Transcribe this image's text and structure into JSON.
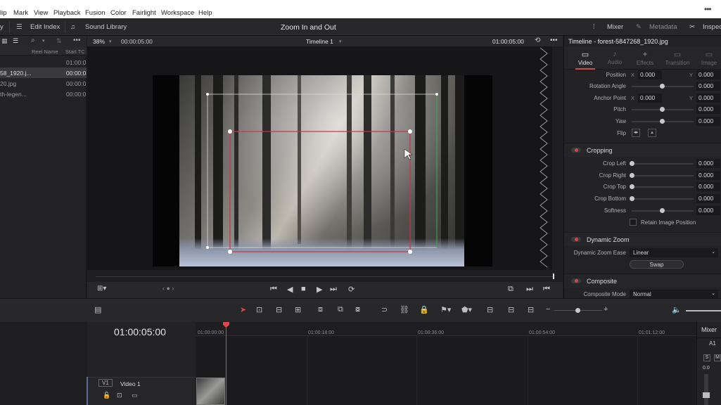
{
  "menubar": {
    "items": [
      "lip",
      "Mark",
      "View",
      "Playback",
      "Fusion",
      "Color",
      "Fairlight",
      "Workspace",
      "Help"
    ]
  },
  "toolbar": {
    "left_fragment": "y",
    "edit_index": "Edit Index",
    "sound_library": "Sound Library",
    "title": "Zoom In and Out",
    "mixer": "Mixer",
    "metadata": "Metadata",
    "inspector": "Inspec"
  },
  "pool": {
    "col_reel": "Reel Name",
    "col_start": "Start TC",
    "rows": [
      {
        "name": "",
        "tc": "01:00:0"
      },
      {
        "name": "58_1920.j...",
        "tc": "00:00:0"
      },
      {
        "name": "20.jpg",
        "tc": "00:00:0"
      },
      {
        "name": "th-legen...",
        "tc": "00:00:0"
      }
    ]
  },
  "viewer": {
    "zoom": "38%",
    "timecode_left": "00:00:05:00",
    "timeline_name": "Timeline 1",
    "timecode_right": "01:00:05:00"
  },
  "inspector": {
    "title": "Timeline - forest-5847268_1920.jpg",
    "tabs": [
      {
        "label": "Video",
        "icon": "video-icon"
      },
      {
        "label": "Audio",
        "icon": "audio-icon"
      },
      {
        "label": "Effects",
        "icon": "effects-icon"
      },
      {
        "label": "Transition",
        "icon": "transition-icon"
      },
      {
        "label": "Image",
        "icon": "image-icon"
      }
    ],
    "transform": {
      "position_label": "Position",
      "position_x": "0.000",
      "position_y": "0.000",
      "rotation_label": "Rotation Angle",
      "rotation": "0.000",
      "anchor_label": "Anchor Point",
      "anchor_x": "0.000",
      "anchor_y": "0.000",
      "pitch_label": "Pitch",
      "pitch": "0.000",
      "yaw_label": "Yaw",
      "yaw": "0.000",
      "flip_label": "Flip",
      "x": "X",
      "y": "Y"
    },
    "cropping": {
      "title": "Cropping",
      "left_label": "Crop Left",
      "left": "0.000",
      "right_label": "Crop Right",
      "right": "0.000",
      "top_label": "Crop Top",
      "top": "0.000",
      "bottom_label": "Crop Bottom",
      "bottom": "0.000",
      "softness_label": "Softness",
      "softness": "0.000",
      "retain_label": "Retain Image Position"
    },
    "dynamic_zoom": {
      "title": "Dynamic Zoom",
      "ease_label": "Dynamic Zoom Ease",
      "ease_value": "Linear",
      "swap_label": "Swap"
    },
    "composite": {
      "title": "Composite",
      "mode_label": "Composite Mode",
      "mode_value": "Normal"
    }
  },
  "timeline": {
    "timecode": "01:00:05:00",
    "ruler": [
      "01:00:00:00",
      "01:00:18:00",
      "01:00:36:00",
      "01:00:54:00",
      "01:01:12:00"
    ],
    "track_id": "V1",
    "track_name": "Video 1"
  },
  "mixer": {
    "title": "Mixer",
    "channel": "A1",
    "s": "S",
    "m": "M",
    "level": "0.0"
  }
}
